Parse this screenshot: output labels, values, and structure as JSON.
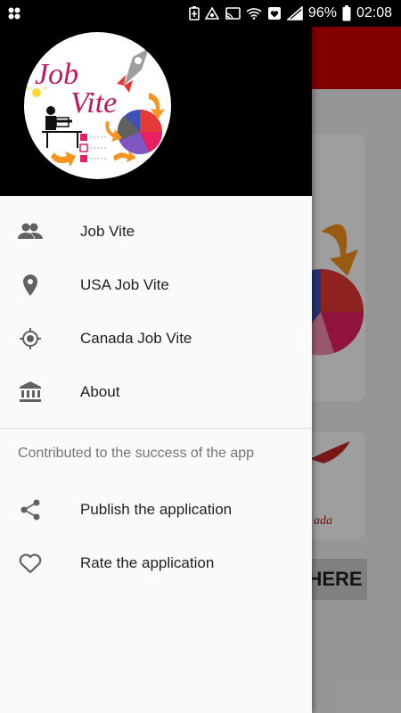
{
  "status_bar": {
    "battery_text": "96%",
    "time_text": "02:08",
    "icons": [
      "app-grid-icon",
      "battery-saver-icon",
      "vpn-icon",
      "cast-icon",
      "wifi-icon",
      "heart-notification-icon",
      "signal-icon",
      "battery-icon"
    ]
  },
  "drawer": {
    "logo_text": [
      "Job",
      "Vite"
    ],
    "primary_items": [
      {
        "label": "Job Vite",
        "icon": "people-icon"
      },
      {
        "label": "USA Job Vite",
        "icon": "location-pin-icon"
      },
      {
        "label": "Canada Job Vite",
        "icon": "gps-target-icon"
      },
      {
        "label": "About",
        "icon": "bank-building-icon"
      }
    ],
    "section_title": "Contributed to the success of the app",
    "secondary_items": [
      {
        "label": "Publish the application",
        "icon": "share-icon"
      },
      {
        "label": "Rate the application",
        "icon": "heart-outline-icon"
      }
    ]
  },
  "background": {
    "button_fragment": "HERE",
    "text_fragment": "ada"
  },
  "colors": {
    "drawer_header": "#000000",
    "drawer_bg": "#fafafa",
    "icon_gray": "#616161",
    "app_bar": "#d50000"
  }
}
